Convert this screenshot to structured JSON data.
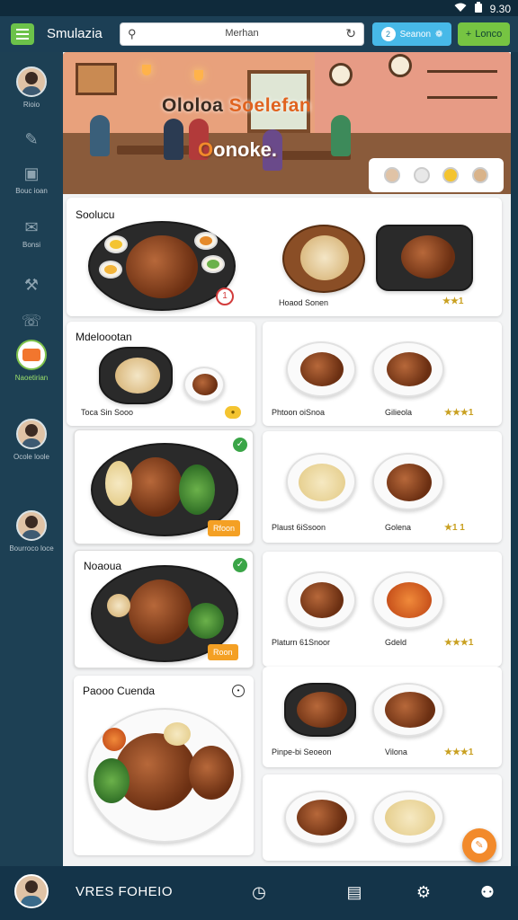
{
  "status_bar": {
    "time": "9.30",
    "wifi_icon": "wifi-icon",
    "battery_icon": "battery-icon"
  },
  "header": {
    "app_title": "Smulazia",
    "search": {
      "text": "Merhan"
    },
    "search_button": {
      "badge": "2",
      "label": "Seanon"
    },
    "green_button": {
      "label": "Lonco"
    }
  },
  "sidebar": {
    "items": [
      {
        "label": "Rioio",
        "icon": "avatar"
      },
      {
        "label": "",
        "icon": "edit-icon"
      },
      {
        "label": "Bouc ioan",
        "icon": "box-icon"
      },
      {
        "label": "Bonsi",
        "icon": "chat-icon"
      },
      {
        "label": "",
        "icon": "tools-icon"
      },
      {
        "label": "",
        "icon": "support-icon"
      },
      {
        "label": "Naoetirian",
        "icon": "food-icon",
        "active": true
      },
      {
        "label": "Ocole loole",
        "icon": "avatar"
      },
      {
        "label": "Bourroco loce",
        "icon": "avatar"
      }
    ]
  },
  "hero": {
    "title_part1": "Ololoa ",
    "title_part2": "Soelefan",
    "subtitle_part1": "O",
    "subtitle_part2": "onoke",
    "subtitle_part3": "."
  },
  "sections": {
    "s1": {
      "title": "Soolucu",
      "badge": "1",
      "item1_caption": "Hoaod Sonen",
      "item2_stars": "★★1"
    },
    "s2": {
      "title": "Mdeloootan",
      "item1_caption": "Toca Sin Sooo",
      "item2_caption": "Phtoon oiSnoa",
      "item3_caption": "Gilieola",
      "item3_stars": "★★★1"
    },
    "s3": {
      "featured_tag": "Rfoon",
      "item1_caption": "Plaust 6iSsoon",
      "item2_caption": "Golena",
      "item2_stars": "★1 1"
    },
    "s4": {
      "title": "Noaoua",
      "featured_tag": "Roon",
      "item1_caption": "Platurn 61Snoor",
      "item2_caption": "Gdeld",
      "item2_stars": "★★★1"
    },
    "s5": {
      "title": "Paooo Cuenda",
      "item1_caption": "Pinpe-bi Seoeon",
      "item2_caption": "Vilona",
      "item2_stars": "★★★1"
    }
  },
  "bottom_nav": {
    "label": "VRES FOHEIO"
  },
  "colors": {
    "accent_green": "#6cc24a",
    "accent_blue": "#47b9e8",
    "accent_orange": "#f28a2b",
    "sidebar_bg": "#1d4054"
  }
}
